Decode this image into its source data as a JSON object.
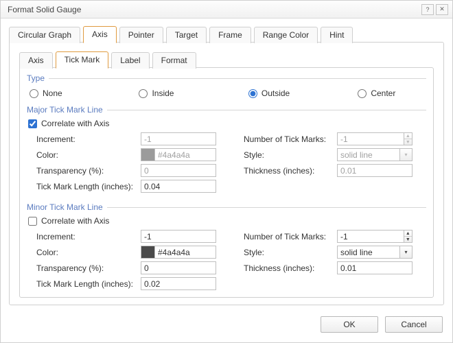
{
  "window": {
    "title": "Format Solid Gauge"
  },
  "outer_tabs": [
    "Circular Graph",
    "Axis",
    "Pointer",
    "Target",
    "Frame",
    "Range Color",
    "Hint"
  ],
  "outer_selected": "Axis",
  "inner_tabs": [
    "Axis",
    "Tick Mark",
    "Label",
    "Format"
  ],
  "inner_selected": "Tick Mark",
  "fs": {
    "type": "Type",
    "major": "Major Tick Mark Line",
    "minor": "Minor Tick Mark Line"
  },
  "type_options": {
    "none": "None",
    "inside": "Inside",
    "outside": "Outside",
    "center": "Center"
  },
  "labels": {
    "correlate": "Correlate with Axis",
    "increment": "Increment:",
    "count": "Number of Tick Marks:",
    "color": "Color:",
    "style": "Style:",
    "transparency": "Transparency (%):",
    "thickness": "Thickness (inches):",
    "ticklen": "Tick Mark Length (inches):"
  },
  "major": {
    "correlate": true,
    "increment": "-1",
    "count": "-1",
    "color": "#4a4a4a",
    "style": "solid line",
    "transparency": "0",
    "thickness": "0.01",
    "ticklen": "0.04"
  },
  "minor": {
    "correlate": false,
    "increment": "-1",
    "count": "-1",
    "color": "#4a4a4a",
    "style": "solid line",
    "transparency": "0",
    "thickness": "0.01",
    "ticklen": "0.02"
  },
  "buttons": {
    "ok": "OK",
    "cancel": "Cancel"
  }
}
